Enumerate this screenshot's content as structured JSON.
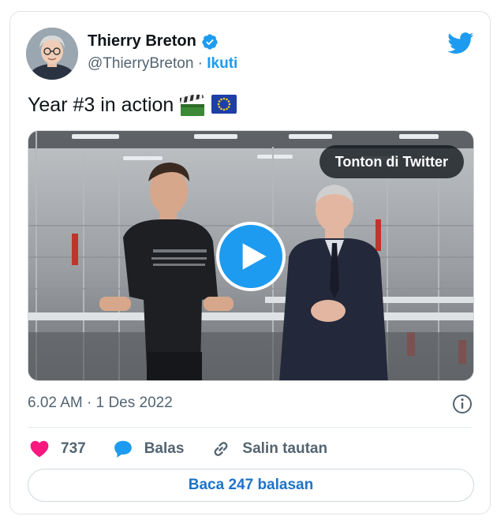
{
  "author": {
    "name": "Thierry Breton",
    "handle": "@ThierryBreton",
    "separator": " · ",
    "follow_label": "Ikuti"
  },
  "tweet": {
    "text": "Year #3 in action",
    "emojis": [
      "clapper-board-emoji",
      "eu-flag-emoji"
    ]
  },
  "media": {
    "watch_label": "Tonton di Twitter",
    "type": "video"
  },
  "meta": {
    "timestamp": "6.02 AM · 1 Des 2022"
  },
  "actions": {
    "like_count": "737",
    "reply_label": "Balas",
    "copy_link_label": "Salin tautan"
  },
  "read_replies_label": "Baca 247 balasan",
  "colors": {
    "brand_blue": "#1d9bf0",
    "like_pink": "#f91880",
    "text_gray": "#536471",
    "link_blue": "#1d73c9"
  }
}
